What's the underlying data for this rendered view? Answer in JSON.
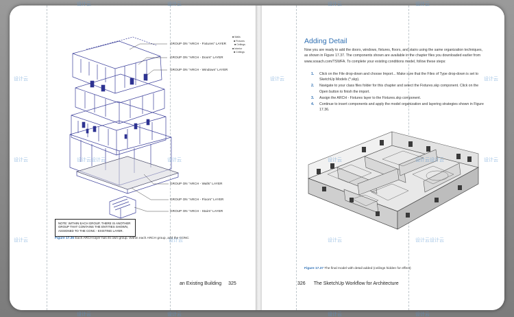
{
  "left_page": {
    "callouts": [
      "GROUP ON \"ARCH - Fixtures\" LAYER",
      "GROUP ON \"ARCH - Doors\" LAYER",
      "GROUP ON \"ARCH - Windows\" LAYER",
      "GROUP ON \"ARCH - Walls\" LAYER",
      "GROUP ON \"ARCH - Floors\" LAYER",
      "GROUP ON \"ARCH - Stairs\" LAYER"
    ],
    "legend": [
      "Walls",
      "Fixtures",
      "Ceilings",
      "Interior",
      "Ceilings"
    ],
    "note": "NOTE: WITHIN EACH GROUP, THERE IS ANOTHER GROUP THAT CONTAINS THE ENTITIES SHOWN, ASSIGNED TO THE CONC - EXISTING LAYER.",
    "caption_label": "Figure 17.36",
    "caption_text": "Each ARCH layer has its own group. Within each ARCH group, add the CONC",
    "footer_text": "an Existing Building",
    "page_number": "325"
  },
  "right_page": {
    "heading": "Adding Detail",
    "intro": "Now you are ready to add the doors, windows, fixtures, floors, and stairs using the same organization techniques, as shown in Figure 17.37. The components shown are available in the chapter files you downloaded earlier from www.sosach.com/TSWFA. To complete your existing conditions model, follow these steps:",
    "steps": [
      {
        "n": "1.",
        "text": "Click on the File drop-down and choose Import... Make sure that the Files of Type drop-down is set to SketchUp Models (*.skp)."
      },
      {
        "n": "2.",
        "text": "Navigate to your class files folder for this chapter and select the Fixtures.skp component. Click on the Open button to finish the import."
      },
      {
        "n": "3.",
        "text": "Assign the ARCH - Fixtures layer to the Fixtures.skp component."
      },
      {
        "n": "4.",
        "text": "Continue to insert components and apply the model organization and layering strategies shown in Figure 17.36."
      }
    ],
    "caption_label": "Figure 17.37",
    "caption_text": "The final model with detail added (ceilings hidden for effect)",
    "page_number": "326",
    "footer_text": "The SketchUp Workflow for Architecture"
  },
  "watermark": {
    "text": "设计云",
    "text_double": "设计云设计云"
  },
  "colors": {
    "accent": "#2f6fb2",
    "diagram_line": "#3b3f9a",
    "viewer_bg": "#f4f4f4"
  }
}
